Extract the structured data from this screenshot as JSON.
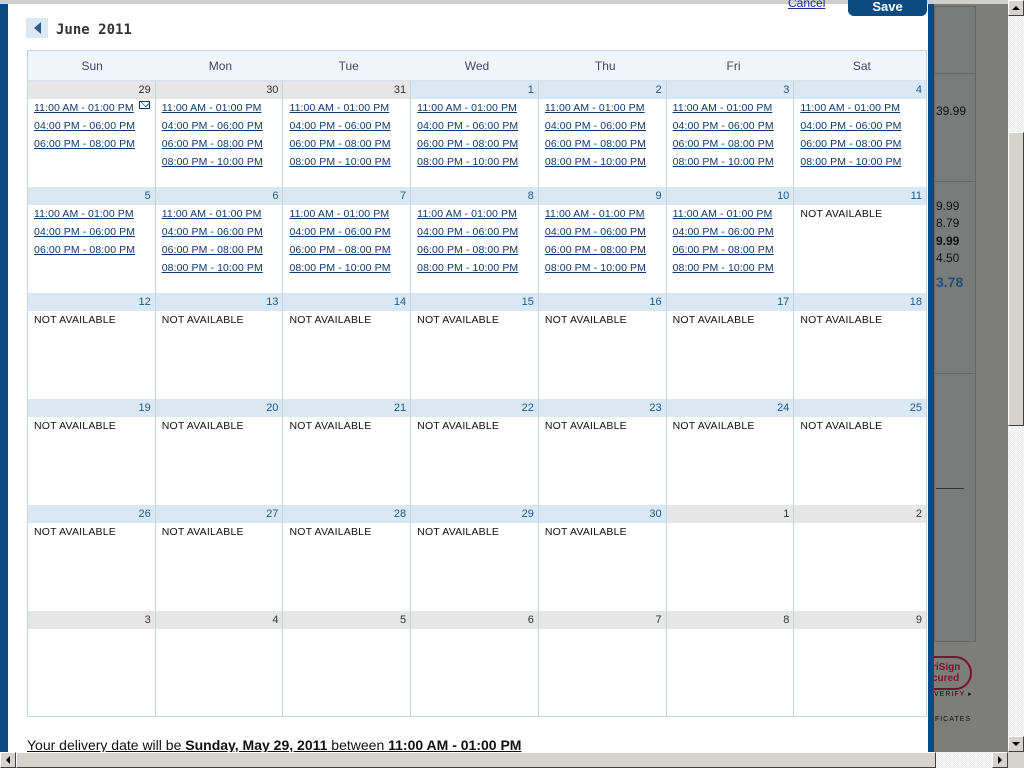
{
  "header": {
    "month_title": "June 2011",
    "prev_icon": "chevron-left-icon",
    "cancel_label": "Cancel",
    "save_label": "Save"
  },
  "calendar": {
    "days_of_week": [
      "Sun",
      "Mon",
      "Tue",
      "Wed",
      "Thu",
      "Fri",
      "Sat"
    ],
    "weeks": [
      [
        {
          "day": "29",
          "other": true,
          "selected": true,
          "slots": [
            "11:00 AM - 01:00 PM",
            "04:00 PM - 06:00 PM",
            "06:00 PM - 08:00 PM"
          ]
        },
        {
          "day": "30",
          "other": true,
          "slots": [
            "11:00 AM - 01:00 PM",
            "04:00 PM - 06:00 PM",
            "06:00 PM - 08:00 PM",
            "08:00 PM - 10:00 PM"
          ]
        },
        {
          "day": "31",
          "other": true,
          "slots": [
            "11:00 AM - 01:00 PM",
            "04:00 PM - 06:00 PM",
            "06:00 PM - 08:00 PM",
            "08:00 PM - 10:00 PM"
          ]
        },
        {
          "day": "1",
          "slots": [
            "11:00 AM - 01:00 PM",
            "04:00 PM - 06:00 PM",
            "06:00 PM - 08:00 PM",
            "08:00 PM - 10:00 PM"
          ]
        },
        {
          "day": "2",
          "slots": [
            "11:00 AM - 01:00 PM",
            "04:00 PM - 06:00 PM",
            "06:00 PM - 08:00 PM",
            "08:00 PM - 10:00 PM"
          ]
        },
        {
          "day": "3",
          "slots": [
            "11:00 AM - 01:00 PM",
            "04:00 PM - 06:00 PM",
            "06:00 PM - 08:00 PM",
            "08:00 PM - 10:00 PM"
          ]
        },
        {
          "day": "4",
          "slots": [
            "11:00 AM - 01:00 PM",
            "04:00 PM - 06:00 PM",
            "06:00 PM - 08:00 PM",
            "08:00 PM - 10:00 PM"
          ]
        }
      ],
      [
        {
          "day": "5",
          "slots": [
            "11:00 AM - 01:00 PM",
            "04:00 PM - 06:00 PM",
            "06:00 PM - 08:00 PM"
          ]
        },
        {
          "day": "6",
          "slots": [
            "11:00 AM - 01:00 PM",
            "04:00 PM - 06:00 PM",
            "06:00 PM - 08:00 PM",
            "08:00 PM - 10:00 PM"
          ]
        },
        {
          "day": "7",
          "slots": [
            "11:00 AM - 01:00 PM",
            "04:00 PM - 06:00 PM",
            "06:00 PM - 08:00 PM",
            "08:00 PM - 10:00 PM"
          ]
        },
        {
          "day": "8",
          "slots": [
            "11:00 AM - 01:00 PM",
            "04:00 PM - 06:00 PM",
            "06:00 PM - 08:00 PM",
            "08:00 PM - 10:00 PM"
          ]
        },
        {
          "day": "9",
          "slots": [
            "11:00 AM - 01:00 PM",
            "04:00 PM - 06:00 PM",
            "06:00 PM - 08:00 PM",
            "08:00 PM - 10:00 PM"
          ]
        },
        {
          "day": "10",
          "slots": [
            "11:00 AM - 01:00 PM",
            "04:00 PM - 06:00 PM",
            "06:00 PM - 08:00 PM",
            "08:00 PM - 10:00 PM"
          ]
        },
        {
          "day": "11",
          "na": "NOT AVAILABLE"
        }
      ],
      [
        {
          "day": "12",
          "na": "NOT AVAILABLE"
        },
        {
          "day": "13",
          "na": "NOT AVAILABLE"
        },
        {
          "day": "14",
          "na": "NOT AVAILABLE"
        },
        {
          "day": "15",
          "na": "NOT AVAILABLE"
        },
        {
          "day": "16",
          "na": "NOT AVAILABLE"
        },
        {
          "day": "17",
          "na": "NOT AVAILABLE"
        },
        {
          "day": "18",
          "na": "NOT AVAILABLE"
        }
      ],
      [
        {
          "day": "19",
          "na": "NOT AVAILABLE"
        },
        {
          "day": "20",
          "na": "NOT AVAILABLE"
        },
        {
          "day": "21",
          "na": "NOT AVAILABLE"
        },
        {
          "day": "22",
          "na": "NOT AVAILABLE"
        },
        {
          "day": "23",
          "na": "NOT AVAILABLE"
        },
        {
          "day": "24",
          "na": "NOT AVAILABLE"
        },
        {
          "day": "25",
          "na": "NOT AVAILABLE"
        }
      ],
      [
        {
          "day": "26",
          "na": "NOT AVAILABLE"
        },
        {
          "day": "27",
          "na": "NOT AVAILABLE"
        },
        {
          "day": "28",
          "na": "NOT AVAILABLE"
        },
        {
          "day": "29",
          "na": "NOT AVAILABLE"
        },
        {
          "day": "30",
          "na": "NOT AVAILABLE"
        },
        {
          "day": "1",
          "other": true
        },
        {
          "day": "2",
          "other": true
        }
      ],
      [
        {
          "day": "3",
          "other": true
        },
        {
          "day": "4",
          "other": true
        },
        {
          "day": "5",
          "other": true
        },
        {
          "day": "6",
          "other": true
        },
        {
          "day": "7",
          "other": true
        },
        {
          "day": "8",
          "other": true
        },
        {
          "day": "9",
          "other": true
        }
      ]
    ]
  },
  "delivery": {
    "prefix": "Your delivery date will be ",
    "date": "Sunday, May 29, 2011",
    "middle": " between ",
    "time": "11:00 AM - 01:00 PM"
  },
  "background": {
    "prices": [
      "39.99",
      "9.99",
      "8.79",
      "9.99",
      "4.50",
      "3.78"
    ],
    "verisign_line1": "riSign",
    "verisign_line2": "cured",
    "verify_text": "VERIFY ▸",
    "certs_text": "IFICATES"
  },
  "colors": {
    "modal_border": "#0a4a7e",
    "link": "#10386a",
    "day_header": "#d9e8f3",
    "other_month_header": "#e6e6e6"
  }
}
